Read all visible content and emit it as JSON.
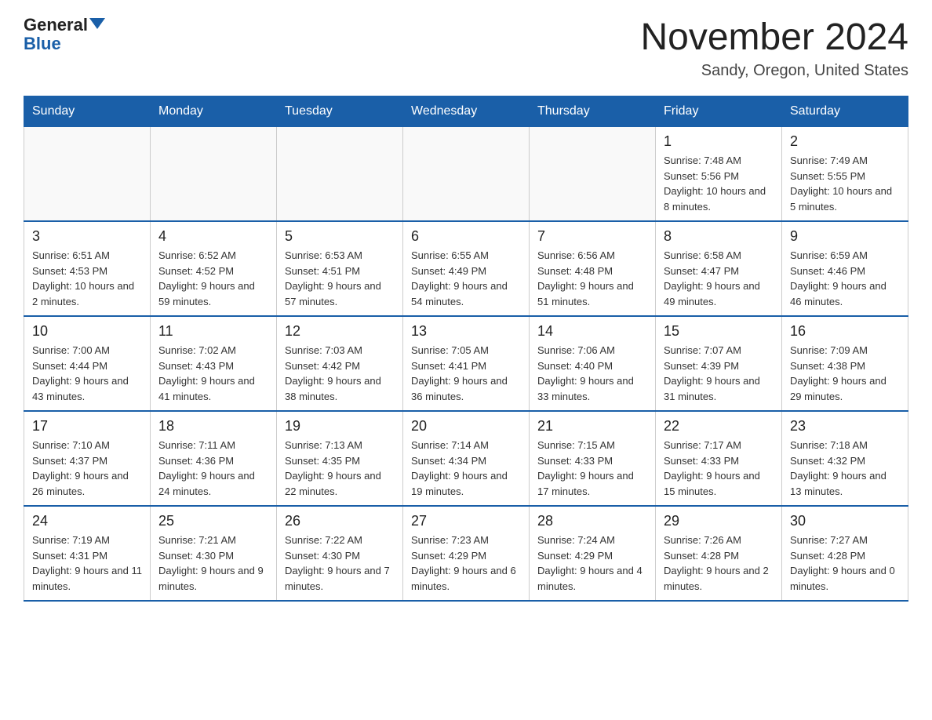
{
  "header": {
    "logo_general": "General",
    "logo_blue": "Blue",
    "month_title": "November 2024",
    "location": "Sandy, Oregon, United States"
  },
  "weekdays": [
    "Sunday",
    "Monday",
    "Tuesday",
    "Wednesday",
    "Thursday",
    "Friday",
    "Saturday"
  ],
  "weeks": [
    [
      {
        "day": "",
        "sunrise": "",
        "sunset": "",
        "daylight": ""
      },
      {
        "day": "",
        "sunrise": "",
        "sunset": "",
        "daylight": ""
      },
      {
        "day": "",
        "sunrise": "",
        "sunset": "",
        "daylight": ""
      },
      {
        "day": "",
        "sunrise": "",
        "sunset": "",
        "daylight": ""
      },
      {
        "day": "",
        "sunrise": "",
        "sunset": "",
        "daylight": ""
      },
      {
        "day": "1",
        "sunrise": "Sunrise: 7:48 AM",
        "sunset": "Sunset: 5:56 PM",
        "daylight": "Daylight: 10 hours and 8 minutes."
      },
      {
        "day": "2",
        "sunrise": "Sunrise: 7:49 AM",
        "sunset": "Sunset: 5:55 PM",
        "daylight": "Daylight: 10 hours and 5 minutes."
      }
    ],
    [
      {
        "day": "3",
        "sunrise": "Sunrise: 6:51 AM",
        "sunset": "Sunset: 4:53 PM",
        "daylight": "Daylight: 10 hours and 2 minutes."
      },
      {
        "day": "4",
        "sunrise": "Sunrise: 6:52 AM",
        "sunset": "Sunset: 4:52 PM",
        "daylight": "Daylight: 9 hours and 59 minutes."
      },
      {
        "day": "5",
        "sunrise": "Sunrise: 6:53 AM",
        "sunset": "Sunset: 4:51 PM",
        "daylight": "Daylight: 9 hours and 57 minutes."
      },
      {
        "day": "6",
        "sunrise": "Sunrise: 6:55 AM",
        "sunset": "Sunset: 4:49 PM",
        "daylight": "Daylight: 9 hours and 54 minutes."
      },
      {
        "day": "7",
        "sunrise": "Sunrise: 6:56 AM",
        "sunset": "Sunset: 4:48 PM",
        "daylight": "Daylight: 9 hours and 51 minutes."
      },
      {
        "day": "8",
        "sunrise": "Sunrise: 6:58 AM",
        "sunset": "Sunset: 4:47 PM",
        "daylight": "Daylight: 9 hours and 49 minutes."
      },
      {
        "day": "9",
        "sunrise": "Sunrise: 6:59 AM",
        "sunset": "Sunset: 4:46 PM",
        "daylight": "Daylight: 9 hours and 46 minutes."
      }
    ],
    [
      {
        "day": "10",
        "sunrise": "Sunrise: 7:00 AM",
        "sunset": "Sunset: 4:44 PM",
        "daylight": "Daylight: 9 hours and 43 minutes."
      },
      {
        "day": "11",
        "sunrise": "Sunrise: 7:02 AM",
        "sunset": "Sunset: 4:43 PM",
        "daylight": "Daylight: 9 hours and 41 minutes."
      },
      {
        "day": "12",
        "sunrise": "Sunrise: 7:03 AM",
        "sunset": "Sunset: 4:42 PM",
        "daylight": "Daylight: 9 hours and 38 minutes."
      },
      {
        "day": "13",
        "sunrise": "Sunrise: 7:05 AM",
        "sunset": "Sunset: 4:41 PM",
        "daylight": "Daylight: 9 hours and 36 minutes."
      },
      {
        "day": "14",
        "sunrise": "Sunrise: 7:06 AM",
        "sunset": "Sunset: 4:40 PM",
        "daylight": "Daylight: 9 hours and 33 minutes."
      },
      {
        "day": "15",
        "sunrise": "Sunrise: 7:07 AM",
        "sunset": "Sunset: 4:39 PM",
        "daylight": "Daylight: 9 hours and 31 minutes."
      },
      {
        "day": "16",
        "sunrise": "Sunrise: 7:09 AM",
        "sunset": "Sunset: 4:38 PM",
        "daylight": "Daylight: 9 hours and 29 minutes."
      }
    ],
    [
      {
        "day": "17",
        "sunrise": "Sunrise: 7:10 AM",
        "sunset": "Sunset: 4:37 PM",
        "daylight": "Daylight: 9 hours and 26 minutes."
      },
      {
        "day": "18",
        "sunrise": "Sunrise: 7:11 AM",
        "sunset": "Sunset: 4:36 PM",
        "daylight": "Daylight: 9 hours and 24 minutes."
      },
      {
        "day": "19",
        "sunrise": "Sunrise: 7:13 AM",
        "sunset": "Sunset: 4:35 PM",
        "daylight": "Daylight: 9 hours and 22 minutes."
      },
      {
        "day": "20",
        "sunrise": "Sunrise: 7:14 AM",
        "sunset": "Sunset: 4:34 PM",
        "daylight": "Daylight: 9 hours and 19 minutes."
      },
      {
        "day": "21",
        "sunrise": "Sunrise: 7:15 AM",
        "sunset": "Sunset: 4:33 PM",
        "daylight": "Daylight: 9 hours and 17 minutes."
      },
      {
        "day": "22",
        "sunrise": "Sunrise: 7:17 AM",
        "sunset": "Sunset: 4:33 PM",
        "daylight": "Daylight: 9 hours and 15 minutes."
      },
      {
        "day": "23",
        "sunrise": "Sunrise: 7:18 AM",
        "sunset": "Sunset: 4:32 PM",
        "daylight": "Daylight: 9 hours and 13 minutes."
      }
    ],
    [
      {
        "day": "24",
        "sunrise": "Sunrise: 7:19 AM",
        "sunset": "Sunset: 4:31 PM",
        "daylight": "Daylight: 9 hours and 11 minutes."
      },
      {
        "day": "25",
        "sunrise": "Sunrise: 7:21 AM",
        "sunset": "Sunset: 4:30 PM",
        "daylight": "Daylight: 9 hours and 9 minutes."
      },
      {
        "day": "26",
        "sunrise": "Sunrise: 7:22 AM",
        "sunset": "Sunset: 4:30 PM",
        "daylight": "Daylight: 9 hours and 7 minutes."
      },
      {
        "day": "27",
        "sunrise": "Sunrise: 7:23 AM",
        "sunset": "Sunset: 4:29 PM",
        "daylight": "Daylight: 9 hours and 6 minutes."
      },
      {
        "day": "28",
        "sunrise": "Sunrise: 7:24 AM",
        "sunset": "Sunset: 4:29 PM",
        "daylight": "Daylight: 9 hours and 4 minutes."
      },
      {
        "day": "29",
        "sunrise": "Sunrise: 7:26 AM",
        "sunset": "Sunset: 4:28 PM",
        "daylight": "Daylight: 9 hours and 2 minutes."
      },
      {
        "day": "30",
        "sunrise": "Sunrise: 7:27 AM",
        "sunset": "Sunset: 4:28 PM",
        "daylight": "Daylight: 9 hours and 0 minutes."
      }
    ]
  ]
}
